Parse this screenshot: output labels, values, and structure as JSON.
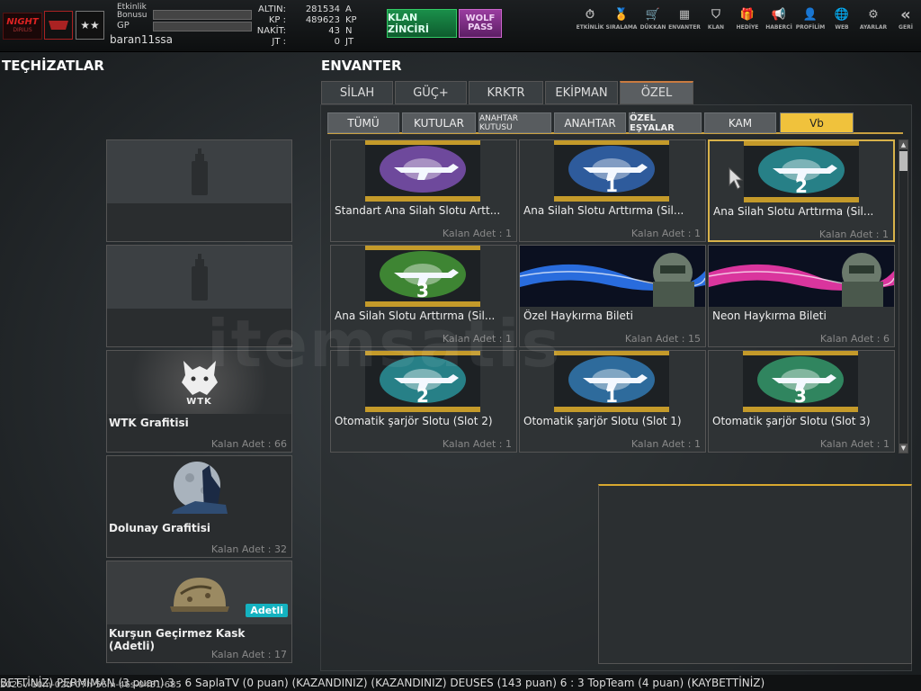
{
  "player": {
    "clan_logo": "NIGHT",
    "clan_sub": "DIRILIS",
    "name": "baran11ssa",
    "bonus_label": "Etkinlik Bonusu",
    "gp_label": "GP",
    "rank_stars": "★★"
  },
  "currency": [
    {
      "label": "ALTIN:",
      "value": "281534",
      "unit": "A"
    },
    {
      "label": "KP :",
      "value": "489623",
      "unit": "KP"
    },
    {
      "label": "NAKİT:",
      "value": "43",
      "unit": "N"
    },
    {
      "label": "JT :",
      "value": "0",
      "unit": "JT"
    }
  ],
  "promo": {
    "clan_chain": "KLAN ZİNCİRİ",
    "wolf_pass": "WOLF PASS"
  },
  "nav": [
    {
      "label": "ETKİNLİK",
      "icon": "clock-icon"
    },
    {
      "label": "SIRALAMA",
      "icon": "medal-icon"
    },
    {
      "label": "DÜKKAN",
      "icon": "cart-icon"
    },
    {
      "label": "ENVANTER",
      "icon": "inventory-icon"
    },
    {
      "label": "KLAN",
      "icon": "shield-icon"
    },
    {
      "label": "HEDİYE",
      "icon": "gift-icon"
    },
    {
      "label": "HABERCİ",
      "icon": "megaphone-icon"
    },
    {
      "label": "PROFİLİM",
      "icon": "profile-icon"
    },
    {
      "label": "WEB",
      "icon": "globe-icon"
    },
    {
      "label": "AYARLAR",
      "icon": "gear-icon"
    },
    {
      "label": "GERİ",
      "icon": "back-icon"
    }
  ],
  "equipment": {
    "title": "TEÇHİZATLAR",
    "items": [
      {
        "name": "",
        "count": "",
        "icon": "spray-can-icon"
      },
      {
        "name": "",
        "count": "",
        "icon": "spray-can-icon"
      },
      {
        "name": "WTK Grafitisi",
        "count": "Kalan Adet : 66",
        "icon": "wolf-icon",
        "art": "WTK"
      },
      {
        "name": "Dolunay Grafitisi",
        "count": "Kalan Adet : 32",
        "icon": "moon-wolf-icon"
      },
      {
        "name": "Kurşun Geçirmez Kask (Adetli)",
        "count": "Kalan Adet : 17",
        "icon": "helmet-icon",
        "badge": "Adetli"
      }
    ]
  },
  "inventory": {
    "title": "ENVANTER",
    "tabs": [
      "SİLAH",
      "GÜÇ+",
      "KRKTR",
      "EKİPMAN",
      "ÖZEL"
    ],
    "active_tab": 4,
    "subtabs": [
      "TÜMÜ",
      "KUTULAR",
      "ANAHTAR KUTUSU",
      "ANAHTAR",
      "ÖZEL EŞYALAR",
      "KAM",
      "Vb"
    ],
    "active_subtab": 6,
    "items": [
      {
        "name": "Standart Ana Silah Slotu Artt...",
        "count": "Kalan Adet : 1",
        "num": "",
        "glow": "#b06cff"
      },
      {
        "name": "Ana Silah Slotu Arttırma (Sil...",
        "count": "Kalan Adet : 1",
        "num": "1",
        "glow": "#3c8cff"
      },
      {
        "name": "Ana Silah Slotu Arttırma (Sil...",
        "count": "Kalan Adet : 1",
        "num": "2",
        "glow": "#2fd0d8"
      },
      {
        "name": "Ana Silah Slotu Arttırma (Sil...",
        "count": "Kalan Adet : 1",
        "num": "3",
        "glow": "#5ad840"
      },
      {
        "name": "Özel Haykırma Bileti",
        "count": "Kalan Adet : 15",
        "num": "",
        "glow": "#2f7cff"
      },
      {
        "name": "Neon Haykırma Bileti",
        "count": "Kalan Adet : 6",
        "num": "",
        "glow": "#ff3cb4"
      },
      {
        "name": "Otomatik şarjör Slotu (Slot 2)",
        "count": "Kalan Adet : 1",
        "num": "2",
        "glow": "#2fd0d8"
      },
      {
        "name": "Otomatik şarjör Slotu (Slot 1)",
        "count": "Kalan Adet : 1",
        "num": "1",
        "glow": "#3caaff"
      },
      {
        "name": "Otomatik şarjör Slotu (Slot 3)",
        "count": "Kalan Adet : 1",
        "num": "3",
        "glow": "#40d890"
      }
    ],
    "selected_item": 2
  },
  "ticker": "BETTİNİZ) PERMIMAN (3 puan) 3 : 6 SaplaTV (0 puan) (KAZANDINIZ)            (KAZANDINIZ) DEUSES (143 puan) 6 : 3 TopTeam (4 puan) (KAYBETTİNİZ)",
  "ticker_ids": "2025v-10m-02d-07h-56m-46s-0431-685",
  "watermark": "itemsatis"
}
